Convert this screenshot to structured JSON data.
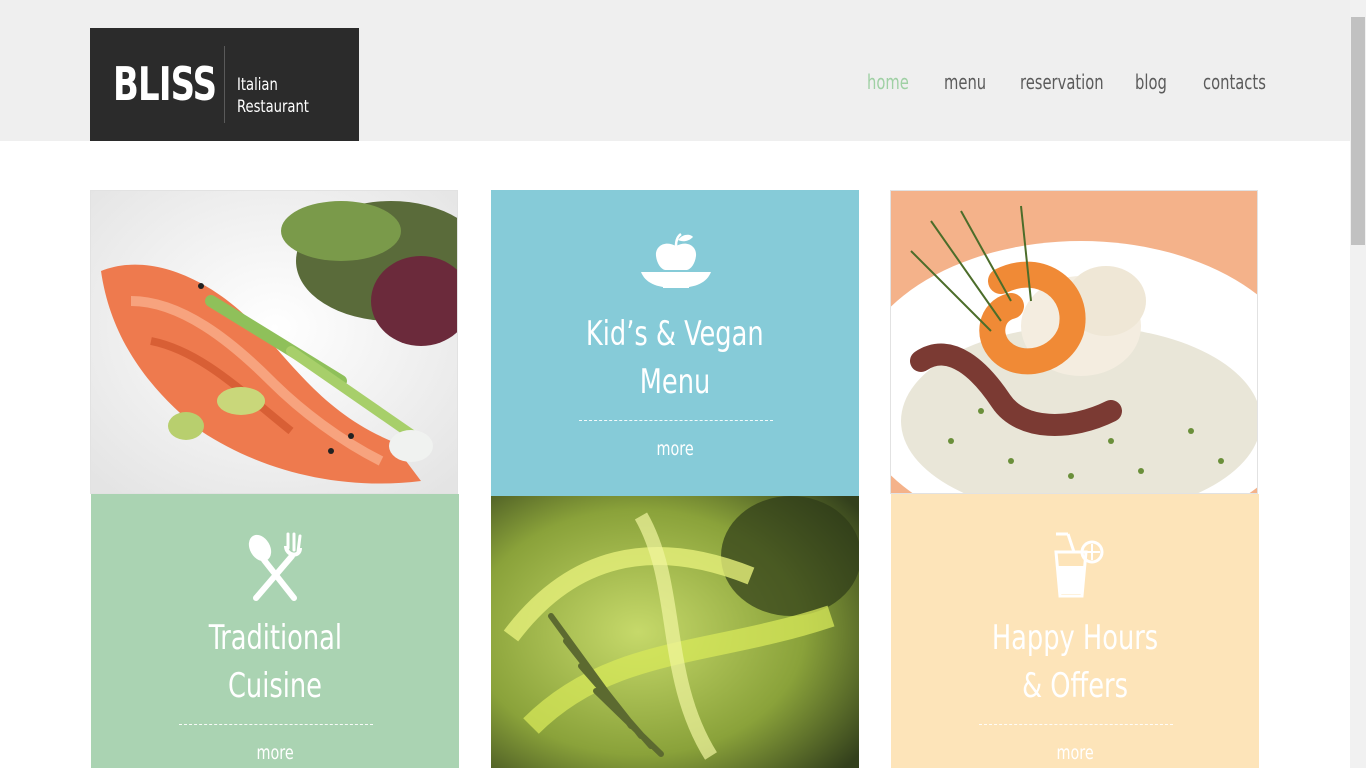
{
  "brand": {
    "name": "BLISS",
    "tagline": "Italian Restaurant"
  },
  "nav": [
    {
      "label": "home",
      "active": true
    },
    {
      "label": "menu",
      "active": false
    },
    {
      "label": "reservation",
      "active": false
    },
    {
      "label": "blog",
      "active": false
    },
    {
      "label": "contacts",
      "active": false
    }
  ],
  "colors": {
    "accent_green": "#9fd0a4",
    "tile_blue": "#86cbd8",
    "tile_green": "#aad3b2",
    "tile_peach": "#fde4b9",
    "logo_bg": "#2b2b2b",
    "header_bg": "#efefef"
  },
  "tiles": [
    {
      "kind": "photo",
      "subject": "salmon and asparagus salad"
    },
    {
      "kind": "text",
      "icon": "apple-bowl-icon",
      "line1": "Kid’s & Vegan",
      "line2": "Menu",
      "more": "more"
    },
    {
      "kind": "photo",
      "subject": "shrimp and octopus risotto"
    },
    {
      "kind": "text",
      "icon": "spoon-fork-icon",
      "line1": "Traditional",
      "line2": "Cuisine",
      "more": "more"
    },
    {
      "kind": "photo",
      "subject": "fork with green pasta"
    },
    {
      "kind": "text",
      "icon": "cocktail-glass-icon",
      "line1": "Happy Hours",
      "line2": "& Offers",
      "more": "more"
    }
  ]
}
